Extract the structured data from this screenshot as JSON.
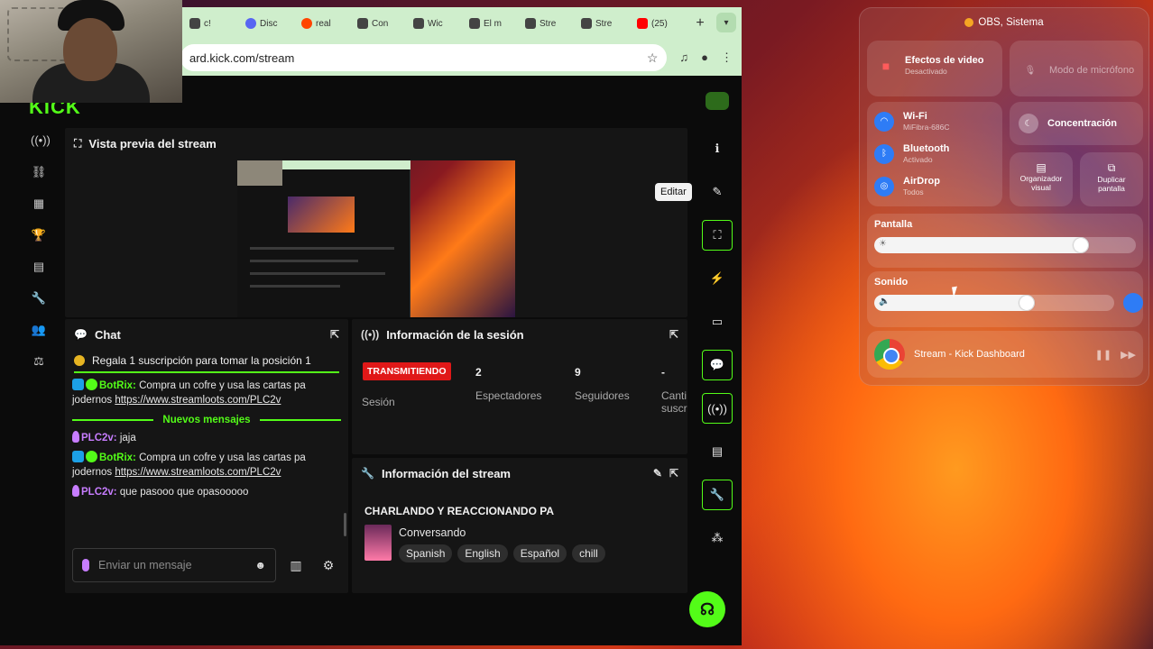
{
  "browser": {
    "tabs": [
      {
        "title": "c!",
        "icon": "page-icon"
      },
      {
        "title": "Disc",
        "icon": "discord-icon"
      },
      {
        "title": "real",
        "icon": "reddit-icon"
      },
      {
        "title": "Con",
        "icon": "page-icon"
      },
      {
        "title": "Wic",
        "icon": "page-icon"
      },
      {
        "title": "El m",
        "icon": "page-icon"
      },
      {
        "title": "Stre",
        "icon": "kick-icon"
      },
      {
        "title": "Stre",
        "icon": "kick-icon"
      },
      {
        "title": "(25)",
        "icon": "youtube-icon"
      }
    ],
    "url": "ard.kick.com/stream"
  },
  "kick": {
    "logo": "KICK",
    "preview_title": "Vista previa del stream",
    "editar_tooltip": "Editar",
    "chat": {
      "title": "Chat",
      "pinned": "Regala 1 suscripción para tomar la posición 1",
      "messages_before": [
        {
          "user": "BotRix:",
          "text": "Compra un cofre y usa las cartas pa jodernos",
          "link": "https://www.streamloots.com/PLC2v"
        }
      ],
      "new_messages_label": "Nuevos mensajes",
      "messages_after": [
        {
          "user": "PLC2v:",
          "text": "jaja",
          "link": ""
        },
        {
          "user": "BotRix:",
          "text": "Compra un cofre y usa las cartas pa jodernos",
          "link": "https://www.streamloots.com/PLC2v"
        },
        {
          "user": "PLC2v:",
          "text": "que pasooo que opasooooo",
          "link": ""
        }
      ],
      "input_placeholder": "Enviar un mensaje"
    },
    "session": {
      "title": "Información de la sesión",
      "live_badge": "TRANSMITIENDO",
      "session_label": "Sesión",
      "viewers_value": "2",
      "viewers_label": "Espectadores",
      "followers_value": "9",
      "followers_label": "Seguidores",
      "subs_value": "-",
      "subs_label_1": "Canti",
      "subs_label_2": "suscr"
    },
    "stream_info": {
      "title": "Información del stream",
      "stream_title": "CHARLANDO Y REACCIONANDO PA",
      "category": "Conversando",
      "tags": [
        "Spanish",
        "English",
        "Español",
        "chill"
      ]
    }
  },
  "control_center": {
    "title": "OBS, Sistema",
    "video_effects": {
      "label": "Efectos de video",
      "sub": "Desactivado"
    },
    "mic_mode": {
      "label": "Modo de micrófono"
    },
    "wifi": {
      "label": "Wi-Fi",
      "sub": "MiFibra-686C"
    },
    "bluetooth": {
      "label": "Bluetooth",
      "sub": "Activado"
    },
    "airdrop": {
      "label": "AirDrop",
      "sub": "Todos"
    },
    "focus": {
      "label": "Concentración"
    },
    "stage_manager": {
      "label_1": "Organizador",
      "label_2": "visual"
    },
    "screen_mirroring": {
      "label_1": "Duplicar",
      "label_2": "pantalla"
    },
    "display": {
      "label": "Pantalla",
      "level": 0.82
    },
    "sound": {
      "label": "Sonido",
      "level": 0.67
    },
    "now_playing": {
      "title": "Stream - Kick Dashboard"
    }
  },
  "colors": {
    "accent": "#53fc18",
    "live": "#e01818"
  }
}
